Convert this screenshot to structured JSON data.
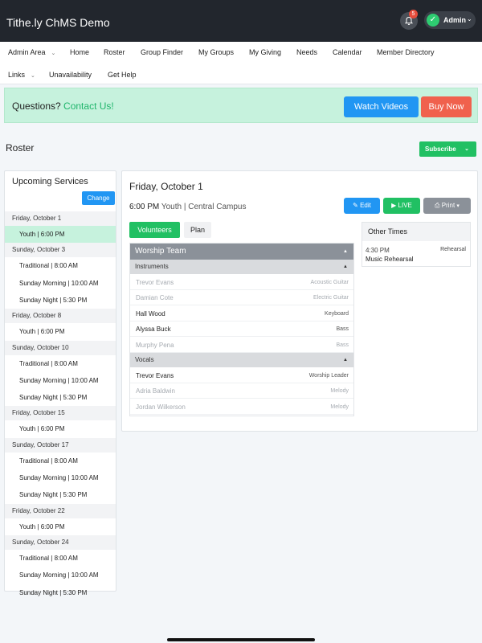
{
  "header": {
    "title": "Tithe.ly ChMS Demo",
    "notifications": "5",
    "admin_label": "Admin"
  },
  "nav": {
    "row1": [
      {
        "label": "Admin Area",
        "dropdown": true
      },
      {
        "label": "Home"
      },
      {
        "label": "Roster"
      },
      {
        "label": "Group Finder"
      },
      {
        "label": "My Groups"
      },
      {
        "label": "My Giving"
      },
      {
        "label": "Needs"
      },
      {
        "label": "Calendar"
      },
      {
        "label": "Member Directory"
      }
    ],
    "row2": [
      {
        "label": "Links",
        "dropdown": true
      },
      {
        "label": "Unavailability"
      },
      {
        "label": "Get Help"
      }
    ]
  },
  "banner": {
    "question": "Questions?",
    "contact": "Contact Us!",
    "watch": "Watch Videos",
    "buy": "Buy Now"
  },
  "page": {
    "title": "Roster",
    "subscribe": "Subscribe"
  },
  "sidebar": {
    "heading": "Upcoming Services",
    "change": "Change",
    "rows": [
      {
        "type": "date",
        "label": "Friday, October 1"
      },
      {
        "type": "svc",
        "label": "Youth | 6:00 PM",
        "active": true
      },
      {
        "type": "date",
        "label": "Sunday, October 3"
      },
      {
        "type": "svc",
        "label": "Traditional | 8:00 AM"
      },
      {
        "type": "svc",
        "label": "Sunday Morning | 10:00 AM"
      },
      {
        "type": "svc",
        "label": "Sunday Night | 5:30 PM"
      },
      {
        "type": "date",
        "label": "Friday, October 8"
      },
      {
        "type": "svc",
        "label": "Youth | 6:00 PM"
      },
      {
        "type": "date",
        "label": "Sunday, October 10"
      },
      {
        "type": "svc",
        "label": "Traditional | 8:00 AM"
      },
      {
        "type": "svc",
        "label": "Sunday Morning | 10:00 AM"
      },
      {
        "type": "svc",
        "label": "Sunday Night | 5:30 PM"
      },
      {
        "type": "date",
        "label": "Friday, October 15"
      },
      {
        "type": "svc",
        "label": "Youth | 6:00 PM"
      },
      {
        "type": "date",
        "label": "Sunday, October 17"
      },
      {
        "type": "svc",
        "label": "Traditional | 8:00 AM"
      },
      {
        "type": "svc",
        "label": "Sunday Morning | 10:00 AM"
      },
      {
        "type": "svc",
        "label": "Sunday Night | 5:30 PM"
      },
      {
        "type": "date",
        "label": "Friday, October 22"
      },
      {
        "type": "svc",
        "label": "Youth | 6:00 PM"
      },
      {
        "type": "date",
        "label": "Sunday, October 24"
      },
      {
        "type": "svc",
        "label": "Traditional | 8:00 AM"
      },
      {
        "type": "svc",
        "label": "Sunday Morning | 10:00 AM"
      },
      {
        "type": "svc",
        "label": "Sunday Night | 5:30 PM"
      }
    ]
  },
  "main": {
    "date": "Friday, October 1",
    "time": "6:00 PM",
    "service": "Youth | Central Campus",
    "edit": "Edit",
    "live": "LIVE",
    "print": "Print",
    "tabs": {
      "volunteers": "Volunteers",
      "plan": "Plan"
    },
    "team": {
      "name": "Worship Team",
      "groups": [
        {
          "name": "Instruments",
          "members": [
            {
              "name": "Trevor Evans",
              "role": "Acoustic Guitar",
              "confirmed": false
            },
            {
              "name": "Damian Cote",
              "role": "Electric Guitar",
              "confirmed": false
            },
            {
              "name": "Hall Wood",
              "role": "Keyboard",
              "confirmed": true
            },
            {
              "name": "Alyssa Buck",
              "role": "Bass",
              "confirmed": true
            },
            {
              "name": "Murphy Pena",
              "role": "Bass",
              "confirmed": false
            }
          ]
        },
        {
          "name": "Vocals",
          "members": [
            {
              "name": "Trevor Evans",
              "role": "Worship Leader",
              "confirmed": true
            },
            {
              "name": "Adria Baldwin",
              "role": "Melody",
              "confirmed": false
            },
            {
              "name": "Jordan Wilkerson",
              "role": "Melody",
              "confirmed": false
            }
          ]
        }
      ]
    },
    "other_times": {
      "heading": "Other Times",
      "items": [
        {
          "time": "4:30 PM",
          "tag": "Rehearsal",
          "name": "Music Rehearsal"
        }
      ]
    }
  },
  "colors": {
    "green": "#21c063",
    "blue": "#2196f3",
    "orange": "#f0614d",
    "dark": "#22262d",
    "gray": "#8b9199"
  }
}
